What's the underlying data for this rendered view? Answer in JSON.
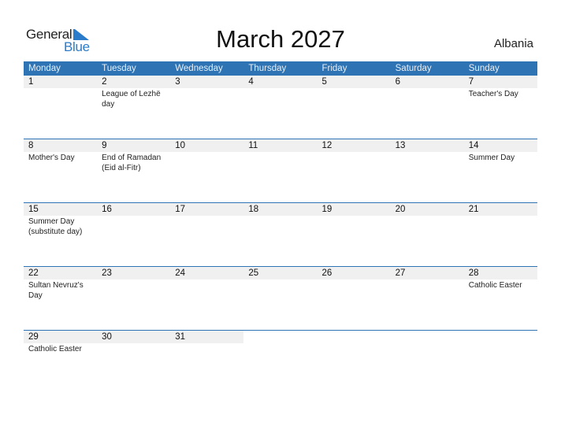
{
  "logo": {
    "line1": "General",
    "line2": "Blue",
    "brand_color": "#2a7bc9"
  },
  "title": "March 2027",
  "country": "Albania",
  "header_color": "#2e73b4",
  "weekdays": [
    "Monday",
    "Tuesday",
    "Wednesday",
    "Thursday",
    "Friday",
    "Saturday",
    "Sunday"
  ],
  "weeks": [
    [
      {
        "day": "1",
        "holiday": ""
      },
      {
        "day": "2",
        "holiday": "League of Lezhë day"
      },
      {
        "day": "3",
        "holiday": ""
      },
      {
        "day": "4",
        "holiday": ""
      },
      {
        "day": "5",
        "holiday": ""
      },
      {
        "day": "6",
        "holiday": ""
      },
      {
        "day": "7",
        "holiday": "Teacher's Day"
      }
    ],
    [
      {
        "day": "8",
        "holiday": "Mother's Day"
      },
      {
        "day": "9",
        "holiday": "End of Ramadan (Eid al-Fitr)"
      },
      {
        "day": "10",
        "holiday": ""
      },
      {
        "day": "11",
        "holiday": ""
      },
      {
        "day": "12",
        "holiday": ""
      },
      {
        "day": "13",
        "holiday": ""
      },
      {
        "day": "14",
        "holiday": "Summer Day"
      }
    ],
    [
      {
        "day": "15",
        "holiday": "Summer Day (substitute day)"
      },
      {
        "day": "16",
        "holiday": ""
      },
      {
        "day": "17",
        "holiday": ""
      },
      {
        "day": "18",
        "holiday": ""
      },
      {
        "day": "19",
        "holiday": ""
      },
      {
        "day": "20",
        "holiday": ""
      },
      {
        "day": "21",
        "holiday": ""
      }
    ],
    [
      {
        "day": "22",
        "holiday": "Sultan Nevruz's Day"
      },
      {
        "day": "23",
        "holiday": ""
      },
      {
        "day": "24",
        "holiday": ""
      },
      {
        "day": "25",
        "holiday": ""
      },
      {
        "day": "26",
        "holiday": ""
      },
      {
        "day": "27",
        "holiday": ""
      },
      {
        "day": "28",
        "holiday": "Catholic Easter"
      }
    ],
    [
      {
        "day": "29",
        "holiday": "Catholic Easter"
      },
      {
        "day": "30",
        "holiday": ""
      },
      {
        "day": "31",
        "holiday": ""
      },
      {
        "day": "",
        "holiday": ""
      },
      {
        "day": "",
        "holiday": ""
      },
      {
        "day": "",
        "holiday": ""
      },
      {
        "day": "",
        "holiday": ""
      }
    ]
  ]
}
